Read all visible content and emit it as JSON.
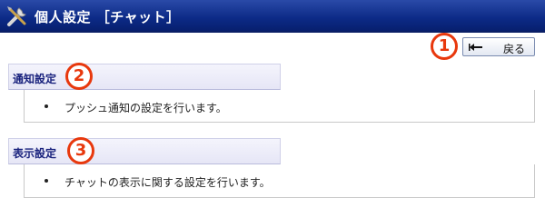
{
  "header": {
    "title": "個人設定 ［チャット］"
  },
  "toolbar": {
    "back_label": "戻る"
  },
  "annotations": {
    "badge1": "1",
    "badge2": "2",
    "badge3": "3"
  },
  "sections": [
    {
      "title": "通知設定",
      "description": "プッシュ通知の設定を行います。"
    },
    {
      "title": "表示設定",
      "description": "チャットの表示に関する設定を行います。"
    }
  ],
  "colors": {
    "titlebar": "#0c2a86",
    "badge": "#e8380d",
    "section_title": "#1a237e"
  }
}
